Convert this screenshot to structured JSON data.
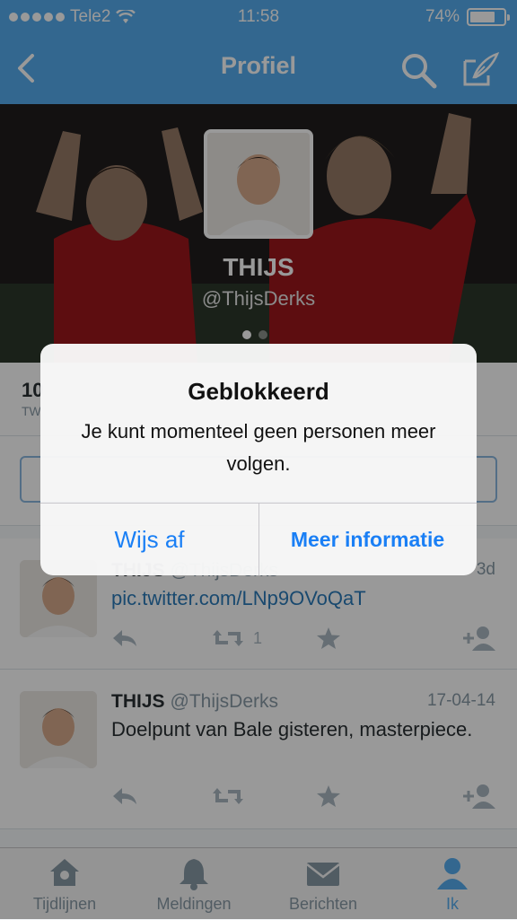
{
  "status": {
    "carrier": "Tele2",
    "time": "11:58",
    "battery": "74%",
    "battery_level": 0.74
  },
  "nav": {
    "title": "Profiel"
  },
  "profile": {
    "name": "THIJS",
    "handle": "@ThijsDerks"
  },
  "stats": {
    "count": "10",
    "label": "TW"
  },
  "tweets": [
    {
      "name": "THIJS",
      "handle": "@ThijsDerks",
      "date": "3d",
      "text": "pic.twitter.com/LNp9OVoQaT",
      "retweets": "1"
    },
    {
      "name": "THIJS",
      "handle": "@ThijsDerks",
      "date": "17-04-14",
      "text": "Doelpunt van Bale gisteren, masterpiece.",
      "retweets": ""
    }
  ],
  "tabs": [
    {
      "label": "Tijdlijnen",
      "icon": "home-icon"
    },
    {
      "label": "Meldingen",
      "icon": "bell-icon"
    },
    {
      "label": "Berichten",
      "icon": "envelope-icon"
    },
    {
      "label": "Ik",
      "icon": "person-icon"
    }
  ],
  "alert": {
    "title": "Geblokkeerd",
    "message": "Je kunt momenteel geen personen meer volgen.",
    "dismiss_label": "Wijs af",
    "more_label": "Meer informatie"
  },
  "colors": {
    "twitter_blue": "#55acee",
    "ios_blue": "#1a7ff5",
    "arsenal_red": "#cf1f24"
  }
}
